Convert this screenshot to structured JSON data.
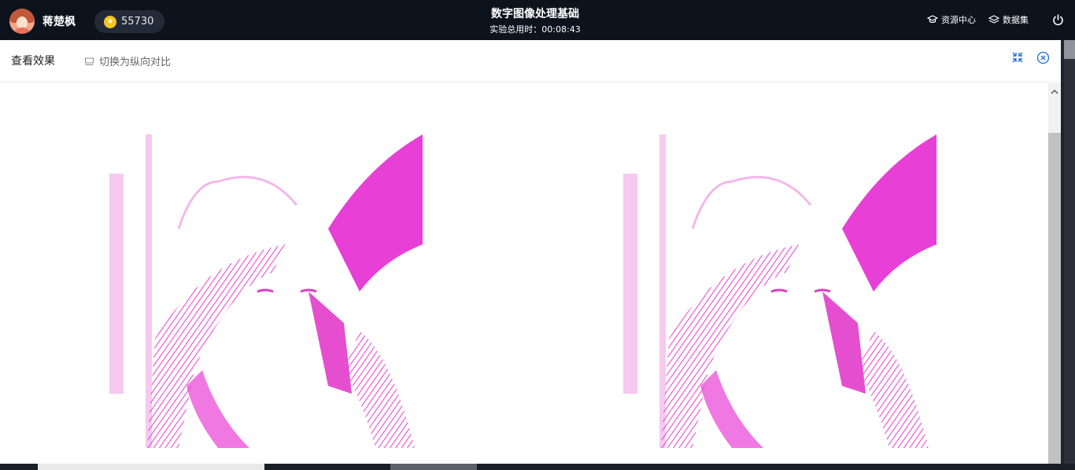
{
  "user": {
    "name": "蒋楚枫",
    "coins": "55730"
  },
  "header": {
    "title": "数字图像处理基础",
    "timer": "实验总用时：00:08:43"
  },
  "nav": {
    "resources": "资源中心",
    "datasets": "数据集"
  },
  "modal": {
    "title": "查看效果",
    "switch_label": "切换为纵向对比"
  },
  "colors": {
    "topbar": "#0d131d",
    "accent": "#1e6fd9",
    "image_tint": "#e83fd6"
  },
  "icons": [
    "power-icon",
    "graduation-cap-icon",
    "layers-icon",
    "collapse-icon",
    "close-circle-icon",
    "layout-icon",
    "coin-icon"
  ]
}
